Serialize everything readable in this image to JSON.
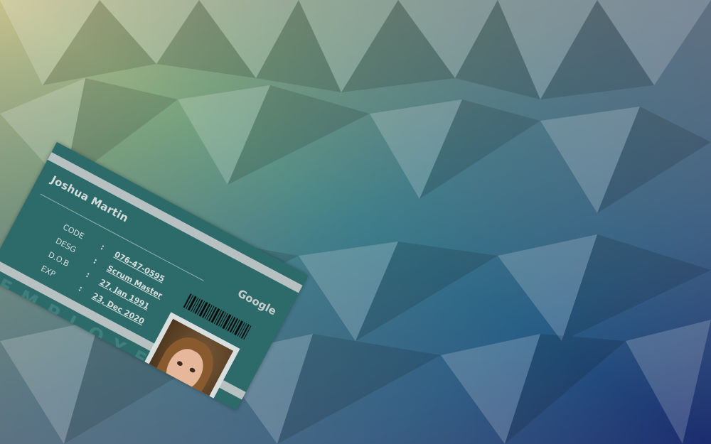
{
  "colors": {
    "card": "#2c6b6a",
    "stripe": "#c0c6c6",
    "text": "#d7dddd"
  },
  "card": {
    "name": "Joshua Martin",
    "company": "Google",
    "fields": [
      {
        "label": "CODE",
        "value": "076-47-0595"
      },
      {
        "label": "DESG",
        "value": "Scrum Master"
      },
      {
        "label": "D.O.B",
        "value": "27, Jan 1991"
      },
      {
        "label": "EXP",
        "value": "23, Dec 2020"
      }
    ],
    "separator": ":",
    "watermark": "EMPLOYE",
    "icons": {
      "photo": "portrait-photo",
      "barcode": "barcode-icon"
    }
  }
}
